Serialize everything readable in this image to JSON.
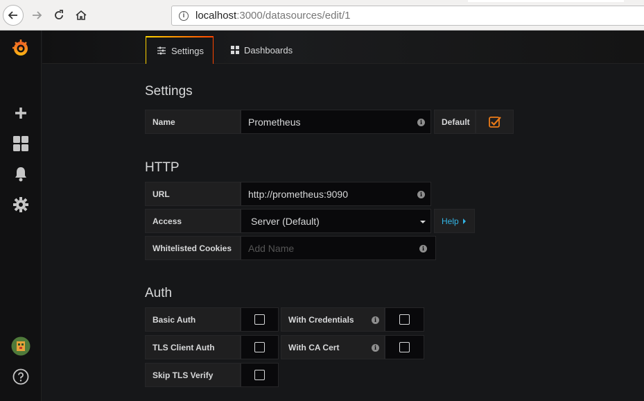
{
  "browser": {
    "url_host": "localhost",
    "url_rest": ":3000/datasources/edit/1"
  },
  "colors": {
    "accent_orange": "#eb7b18",
    "link_blue": "#33b5e5",
    "panel_bg": "#161719"
  },
  "sidebar": {
    "icons": [
      "grafana-logo-icon",
      "plus-icon",
      "dashboards-icon",
      "alerting-bell-icon",
      "configuration-gear-icon",
      "user-avatar-icon",
      "help-icon"
    ]
  },
  "tabs": [
    {
      "label": "Settings",
      "icon": "sliders-icon"
    },
    {
      "label": "Dashboards",
      "icon": "grid-icon"
    }
  ],
  "settings": {
    "title": "Settings",
    "name_label": "Name",
    "name_value": "Prometheus",
    "default_label": "Default",
    "default_checked": true
  },
  "http": {
    "title": "HTTP",
    "url_label": "URL",
    "url_value": "http://prometheus:9090",
    "access_label": "Access",
    "access_value": "Server (Default)",
    "help_label": "Help",
    "cookies_label": "Whitelisted Cookies",
    "cookies_placeholder": "Add Name"
  },
  "auth": {
    "title": "Auth",
    "basic_auth": "Basic Auth",
    "with_credentials": "With Credentials",
    "tls_client_auth": "TLS Client Auth",
    "with_ca_cert": "With CA Cert",
    "skip_tls_verify": "Skip TLS Verify"
  }
}
